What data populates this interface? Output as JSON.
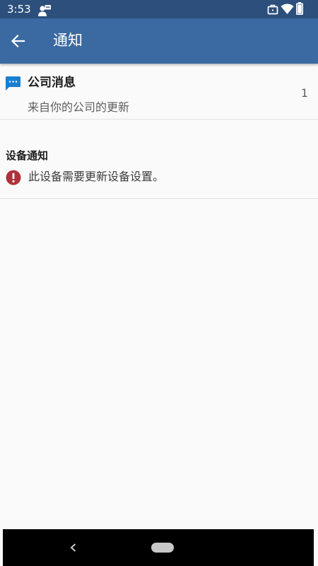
{
  "status_bar": {
    "time": "3:53",
    "icons": [
      "work-profile-icon",
      "briefcase-icon",
      "wifi-icon",
      "battery-icon"
    ]
  },
  "app_bar": {
    "title": "通知",
    "back_icon": "arrow-left-icon",
    "background": "#3a6aa1"
  },
  "company_messages": {
    "title": "公司消息",
    "subtitle": "来自你的公司的更新",
    "count": "1",
    "icon": "chat-bubble-icon",
    "icon_color": "#1a7fd1"
  },
  "device_notifications": {
    "heading": "设备通知",
    "items": [
      {
        "text": "此设备需要更新设备设置。",
        "icon": "alert-icon",
        "icon_color": "#b0313b"
      }
    ]
  },
  "nav_bar": {
    "back_icon": "chevron-left-icon",
    "home_icon": "home-pill-icon"
  }
}
